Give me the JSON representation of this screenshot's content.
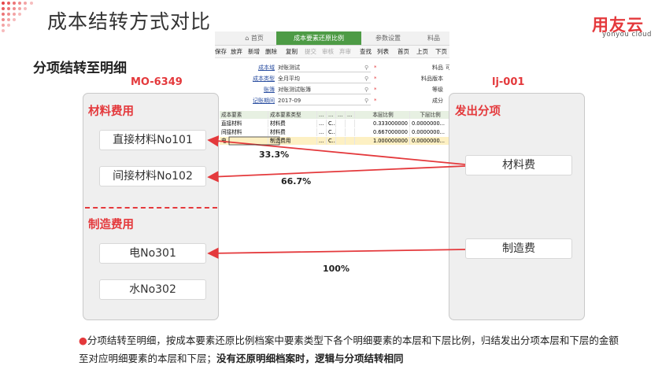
{
  "header": {
    "title": "成本结转方式对比",
    "logo_main": "用友云",
    "logo_sub": "yonyou cloud"
  },
  "subtitle": "分项结转至明细",
  "codes": {
    "left": "MO-6349",
    "right": "lj-001"
  },
  "app": {
    "tabs": [
      {
        "label": "首页",
        "icon": "home-icon"
      },
      {
        "label": "成本要素还原比例",
        "active": true
      },
      {
        "label": "参数设置"
      },
      {
        "label": "料品"
      }
    ],
    "toolbar": [
      {
        "label": "保存"
      },
      {
        "label": "放弃"
      },
      {
        "label": "新增"
      },
      {
        "label": "删除"
      },
      {
        "label": "复制"
      },
      {
        "label": "提交",
        "disabled": true
      },
      {
        "label": "审核",
        "disabled": true
      },
      {
        "label": "弃审",
        "disabled": true
      },
      {
        "label": "查找"
      },
      {
        "label": "列表"
      },
      {
        "label": "首页"
      },
      {
        "label": "上页"
      },
      {
        "label": "下页"
      }
    ],
    "form": [
      {
        "label": "成本域",
        "value": "对账测试"
      },
      {
        "label": "成本类型",
        "value": "全月平均"
      },
      {
        "label": "账簿",
        "value": "对账测试账簿"
      },
      {
        "label": "记账期间",
        "value": "2017-09"
      }
    ],
    "form_right": [
      {
        "label": "料品",
        "value": "可"
      },
      {
        "label": "料品版本",
        "value": ""
      },
      {
        "label": "等级",
        "value": ""
      },
      {
        "label": "成分",
        "value": ""
      }
    ],
    "grid": {
      "headers": [
        "成本要素",
        "成本要素类型",
        "...",
        "...",
        "...",
        "...",
        "本层比例",
        "下层比例"
      ],
      "rows": [
        [
          "直接材料",
          "材料费",
          "...",
          "C...",
          "",
          "",
          "0.333000000",
          "0.0000000..."
        ],
        [
          "间接材料",
          "材料费",
          "...",
          "C...",
          "",
          "",
          "0.667000000",
          "0.0000000..."
        ],
        [
          "电",
          "制造费用",
          "...",
          "C...",
          "",
          "",
          "1.000000000",
          "0.0000000..."
        ]
      ]
    }
  },
  "left_panel": {
    "section1_title": "材料费用",
    "items1": [
      "直接材料No101",
      "间接材料No102"
    ],
    "section2_title": "制造费用",
    "items2": [
      "电No301",
      "水No302"
    ]
  },
  "right_panel": {
    "title": "发出分项",
    "items": [
      "材料费",
      "制造费"
    ]
  },
  "percentages": {
    "p1": "33.3%",
    "p2": "66.7%",
    "p3": "100%"
  },
  "note": {
    "text": "分项结转至明细，按成本要素还原比例档案中要素类型下各个明细要素的本层和下层比例，归结发出分项本层和下层的金额至对应明细要素的本层和下层；",
    "bold": "没有还原明细档案时，逻辑与分项结转相同"
  },
  "colors": {
    "accent": "#e4393c",
    "app_green": "#4d9b45",
    "panel_bg": "#efefef"
  }
}
